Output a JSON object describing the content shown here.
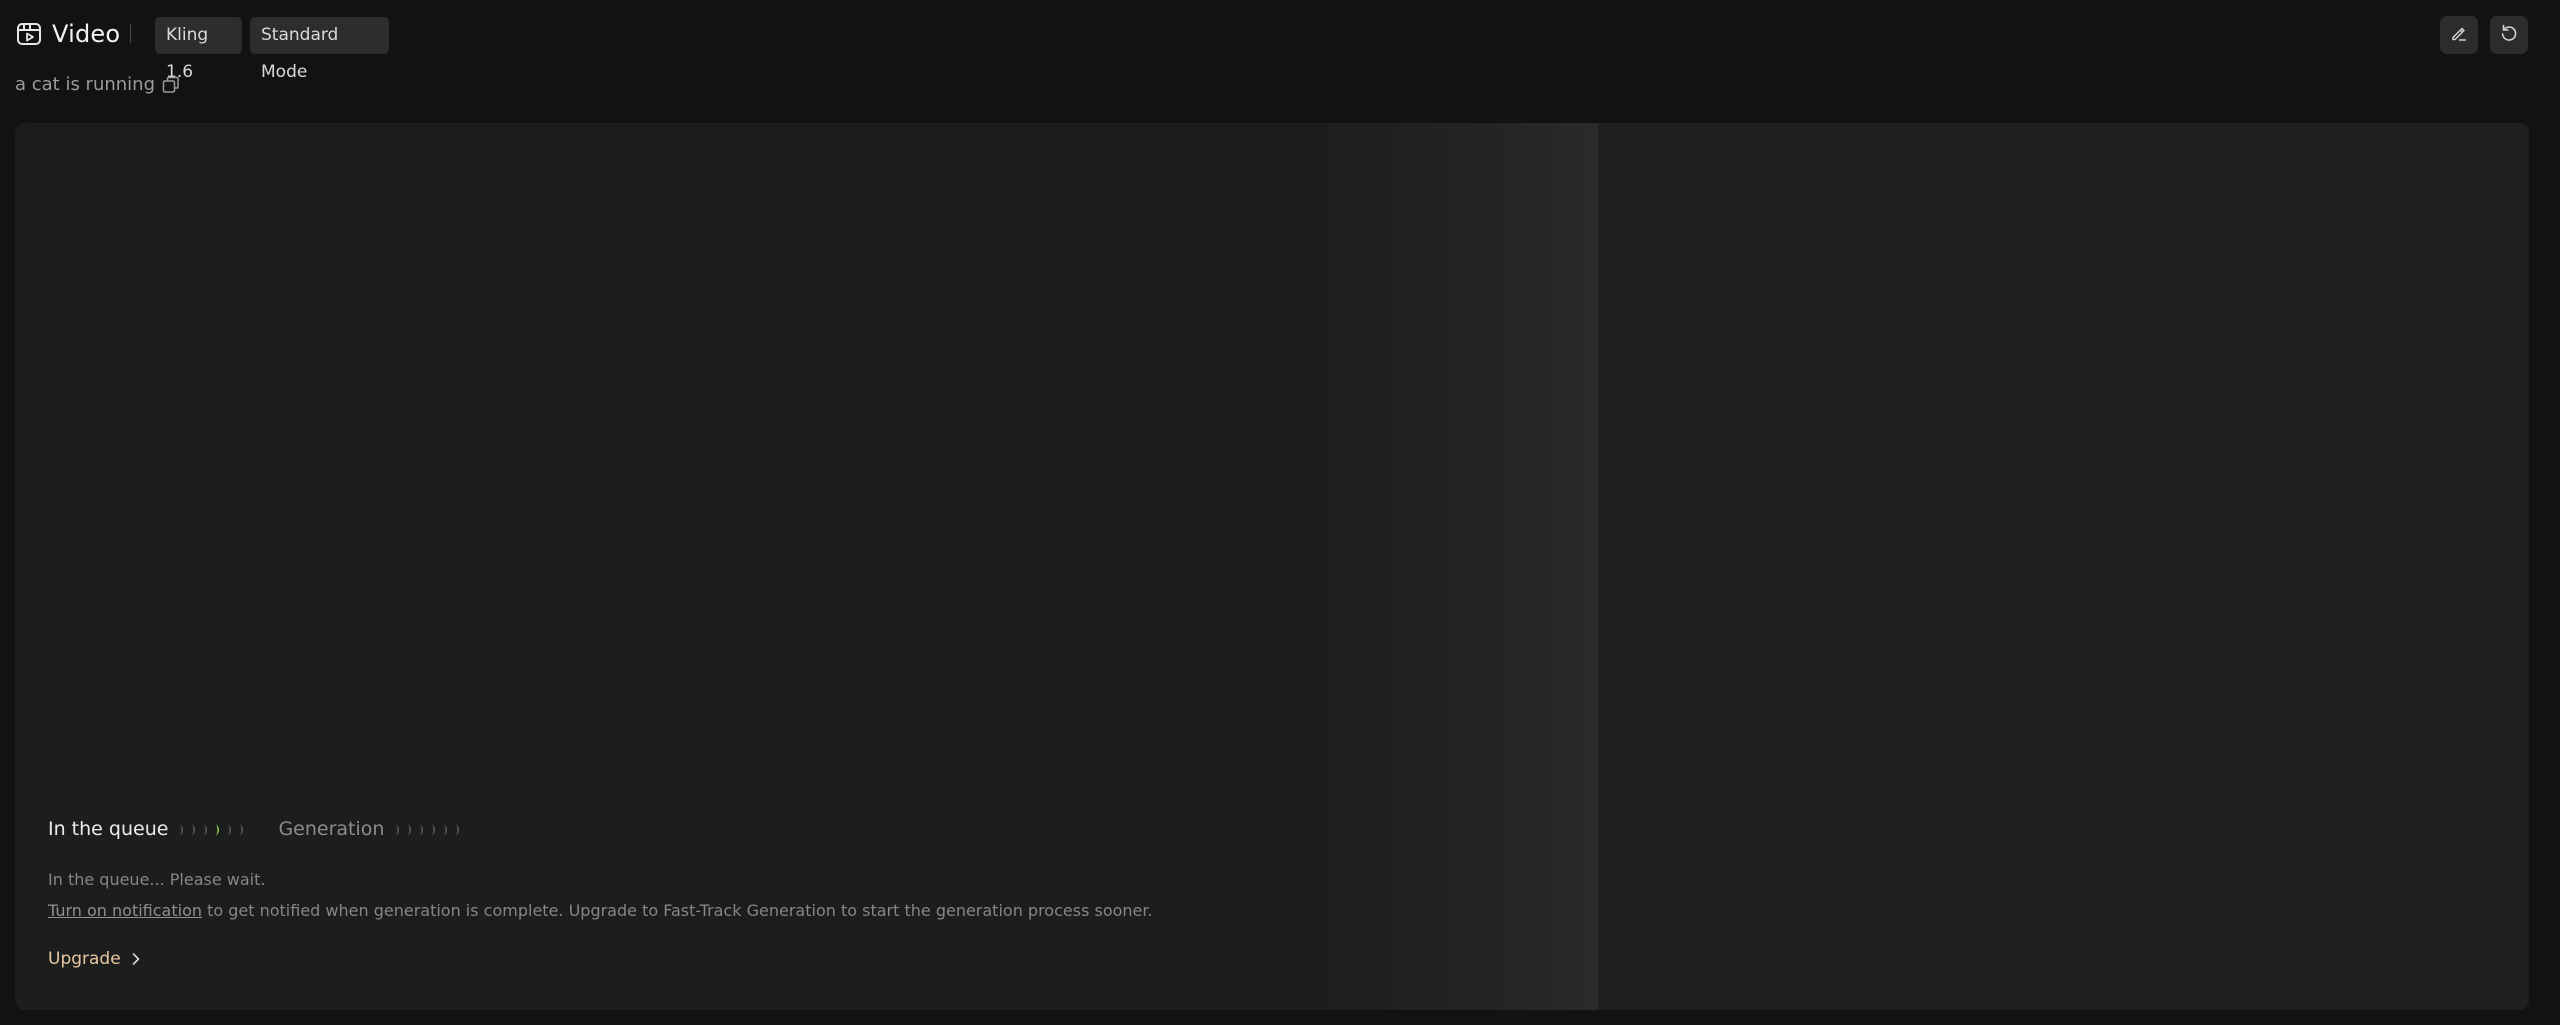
{
  "header": {
    "title": "Video",
    "model_tag": "Kling 1.6",
    "mode_tag": "Standard Mode",
    "icons": [
      "video-icon",
      "edit-icon",
      "refresh-icon"
    ]
  },
  "prompt": {
    "text": "a cat is running",
    "icon": "copy-icon"
  },
  "status": {
    "stage_queue": "In the queue",
    "stage_generation": "Generation",
    "queue_progress_active_index": 3,
    "queue_progress_total": 6,
    "generation_progress_total": 6,
    "message": "In the queue... Please wait.",
    "notification_link": "Turn on notification",
    "notification_rest": " to get notified when generation is complete. Upgrade to Fast-Track Generation to start the generation process sooner.",
    "upgrade_label": "Upgrade"
  },
  "colors": {
    "background": "#111313",
    "card": "#1c1e1e",
    "accent_green": "#8fd14f",
    "upgrade_text": "#e8c7a0"
  }
}
